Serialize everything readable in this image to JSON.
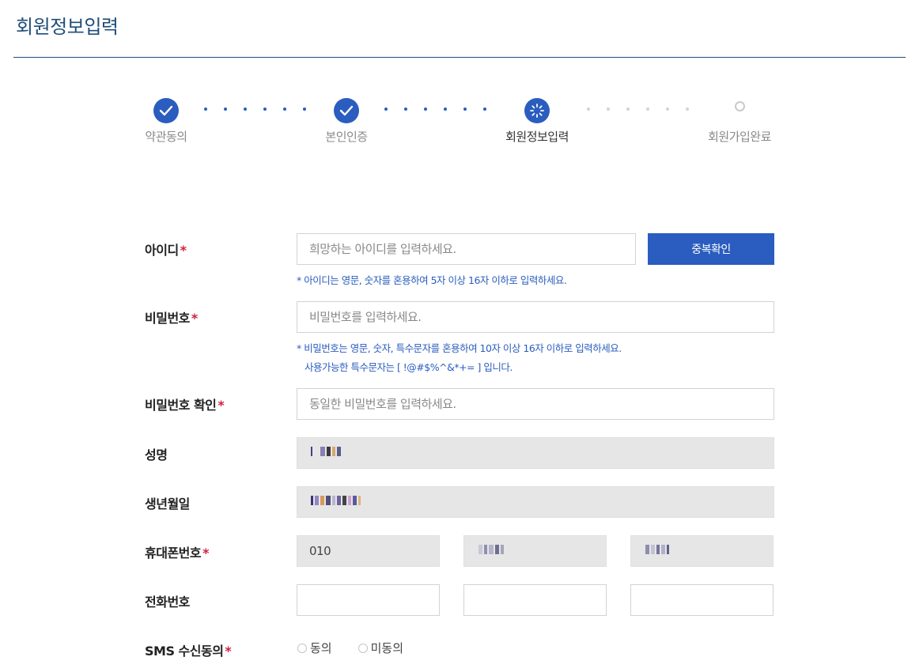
{
  "page": {
    "title": "회원정보입력"
  },
  "stepper": {
    "steps": [
      {
        "label": "약관동의",
        "state": "done"
      },
      {
        "label": "본인인증",
        "state": "done"
      },
      {
        "label": "회원정보입력",
        "state": "current"
      },
      {
        "label": "회원가입완료",
        "state": "pending"
      }
    ]
  },
  "form": {
    "id": {
      "label": "아이디",
      "placeholder": "희망하는 아이디를 입력하세요.",
      "check_button": "중복확인",
      "hint": "* 아이디는 영문, 숫자를 혼용하여 5자 이상 16자 이하로 입력하세요."
    },
    "password": {
      "label": "비밀번호",
      "placeholder": "비밀번호를 입력하세요.",
      "hint_line1": "* 비밀번호는 영문, 숫자, 특수문자를 혼용하여 10자 이상 16자 이하로 입력하세요.",
      "hint_line2": "사용가능한 특수문자는 [ !@#$%^&*+= ] 입니다."
    },
    "password_confirm": {
      "label": "비밀번호 확인",
      "placeholder": "동일한 비밀번호를 입력하세요."
    },
    "name": {
      "label": "성명"
    },
    "birth": {
      "label": "생년월일"
    },
    "mobile": {
      "label": "휴대폰번호",
      "prefix": "010"
    },
    "phone": {
      "label": "전화번호"
    },
    "sms": {
      "label": "SMS 수신동의",
      "agree": "동의",
      "disagree": "미동의"
    },
    "required_mark": "*"
  },
  "colors": {
    "brand": "#2a5dbf",
    "title": "#1f4e79",
    "required": "#d21f3c",
    "readonly_bg": "#e6e6e6"
  }
}
